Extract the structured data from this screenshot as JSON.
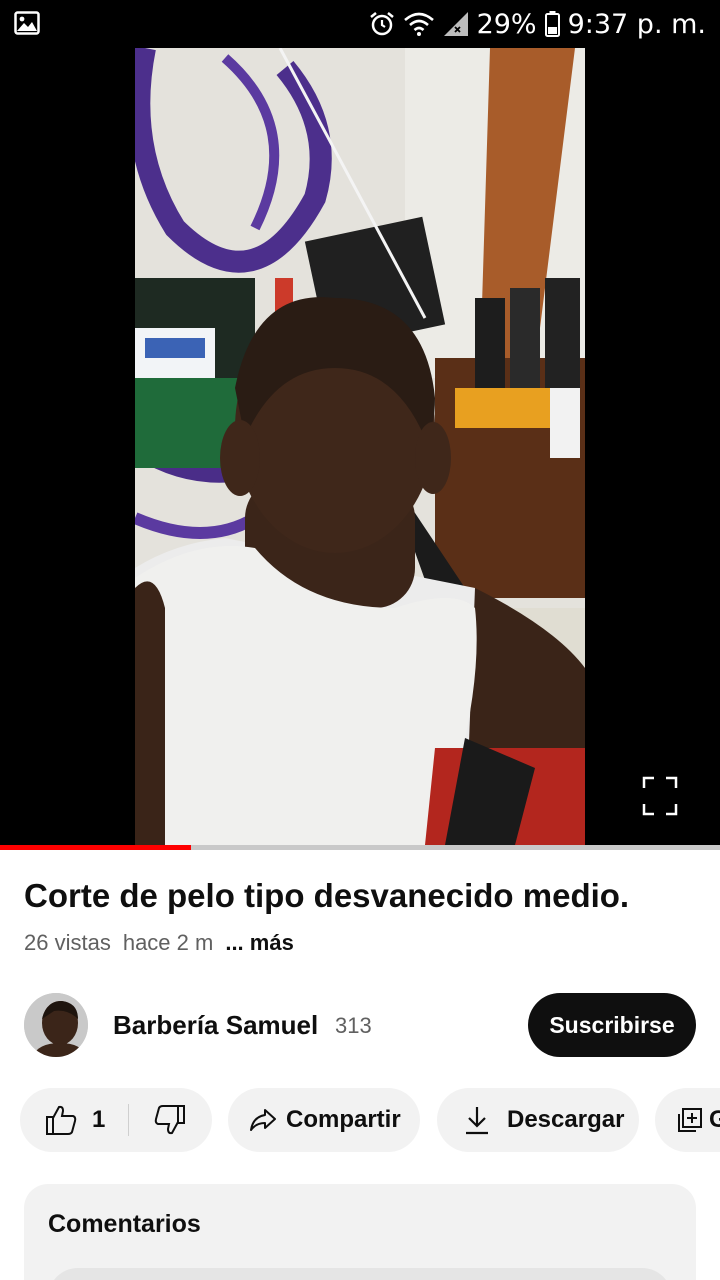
{
  "status_bar": {
    "battery": "29%",
    "time": "9:37 p. m."
  },
  "video": {
    "progress": 0.265
  },
  "info": {
    "title": "Corte de pelo tipo desvanecido medio.",
    "views": "26 vistas",
    "age": "hace 2 m",
    "more": "... más"
  },
  "channel": {
    "name": "Barbería Samuel",
    "subscribers": "313",
    "subscribe_label": "Suscribirse"
  },
  "actions": {
    "likes": "1",
    "share_label": "Compartir",
    "download_label": "Descargar",
    "save_label": "G"
  },
  "comments": {
    "title": "Comentarios"
  },
  "colors": {
    "progress_fill": "#ff0000",
    "subscribe_bg": "#0f0f0f",
    "pill_bg": "#f2f2f2"
  },
  "icons": [
    "gallery-icon",
    "alarm-icon",
    "wifi-icon",
    "signal-icon",
    "battery-icon",
    "fullscreen-icon",
    "like-icon",
    "dislike-icon",
    "share-icon",
    "download-icon",
    "save-icon"
  ]
}
